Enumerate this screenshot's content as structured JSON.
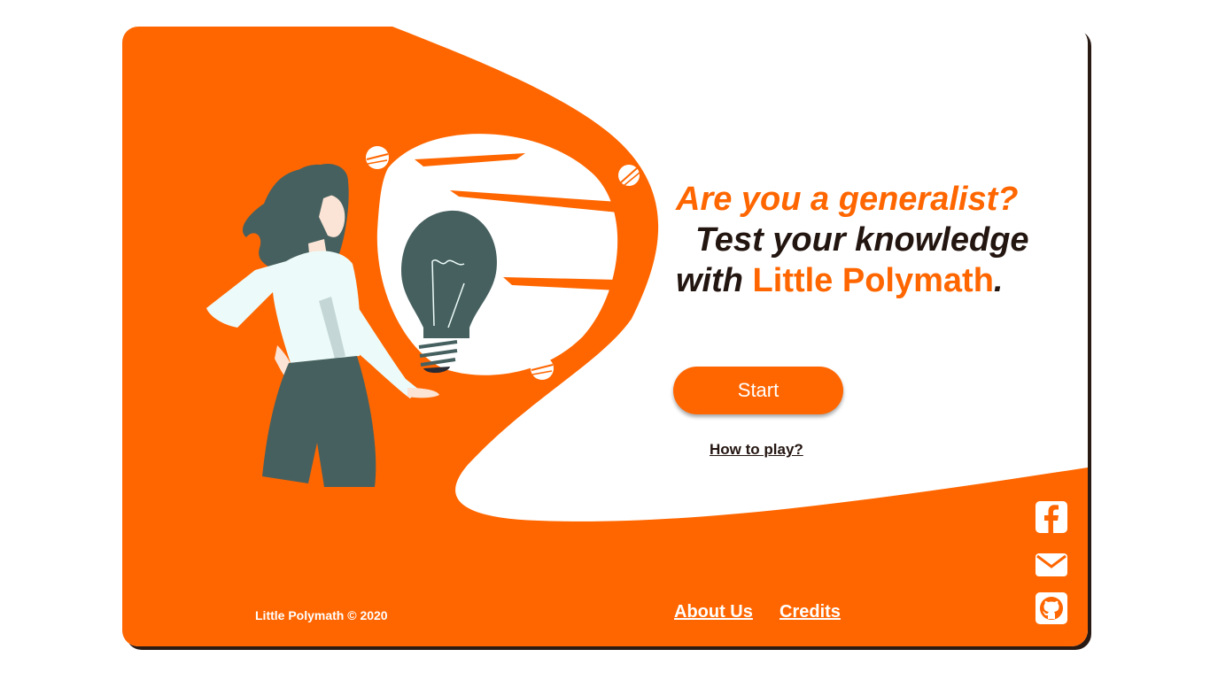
{
  "hero": {
    "question": "Are you a generalist?",
    "line2": "Test your knowledge",
    "with": "with ",
    "brand": "Little Polymath",
    "period": "."
  },
  "actions": {
    "start_label": "Start",
    "how_to_play_label": "How to play?"
  },
  "footer": {
    "copyright": "Little Polymath © 2020",
    "about_label": "About Us",
    "credits_label": "Credits"
  },
  "social": {
    "icons": [
      "facebook-icon",
      "mail-icon",
      "github-icon"
    ]
  },
  "colors": {
    "accent": "#ff6600",
    "dark_text": "#231510",
    "figure_dark": "#46605f",
    "figure_light": "#ecfbf9",
    "background": "#ffffff"
  }
}
